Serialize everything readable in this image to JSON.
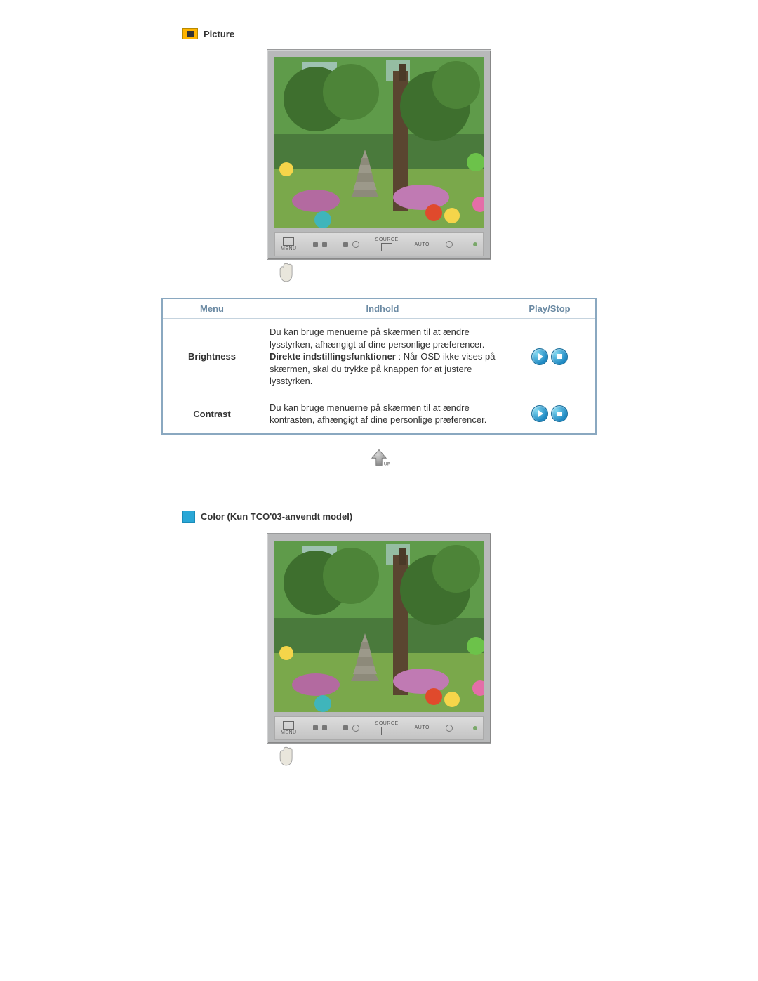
{
  "sections": {
    "picture": {
      "title": "Picture",
      "monitor": {
        "panelLabels": {
          "menu": "MENU",
          "source": "SOURCE",
          "auto": "AUTO"
        }
      }
    },
    "color": {
      "title": "Color (Kun TCO'03-anvendt model)",
      "monitor": {
        "panelLabels": {
          "menu": "MENU",
          "source": "SOURCE",
          "auto": "AUTO"
        }
      }
    }
  },
  "table": {
    "headers": {
      "menu": "Menu",
      "content": "Indhold",
      "play": "Play/Stop"
    },
    "rows": [
      {
        "label": "Brightness",
        "content_pre": "Du kan bruge menuerne på skærmen til at ændre lysstyrken, afhængigt af dine personlige præferencer.",
        "content_bold": "Direkte indstillingsfunktioner",
        "content_post": " : Når OSD ikke vises på skærmen, skal du trykke på knappen for at justere lysstyrken."
      },
      {
        "label": "Contrast",
        "content_pre": "Du kan bruge menuerne på skærmen til at ændre kontrasten, afhængigt af dine personlige præferencer.",
        "content_bold": "",
        "content_post": ""
      }
    ]
  },
  "upLabel": "UP"
}
